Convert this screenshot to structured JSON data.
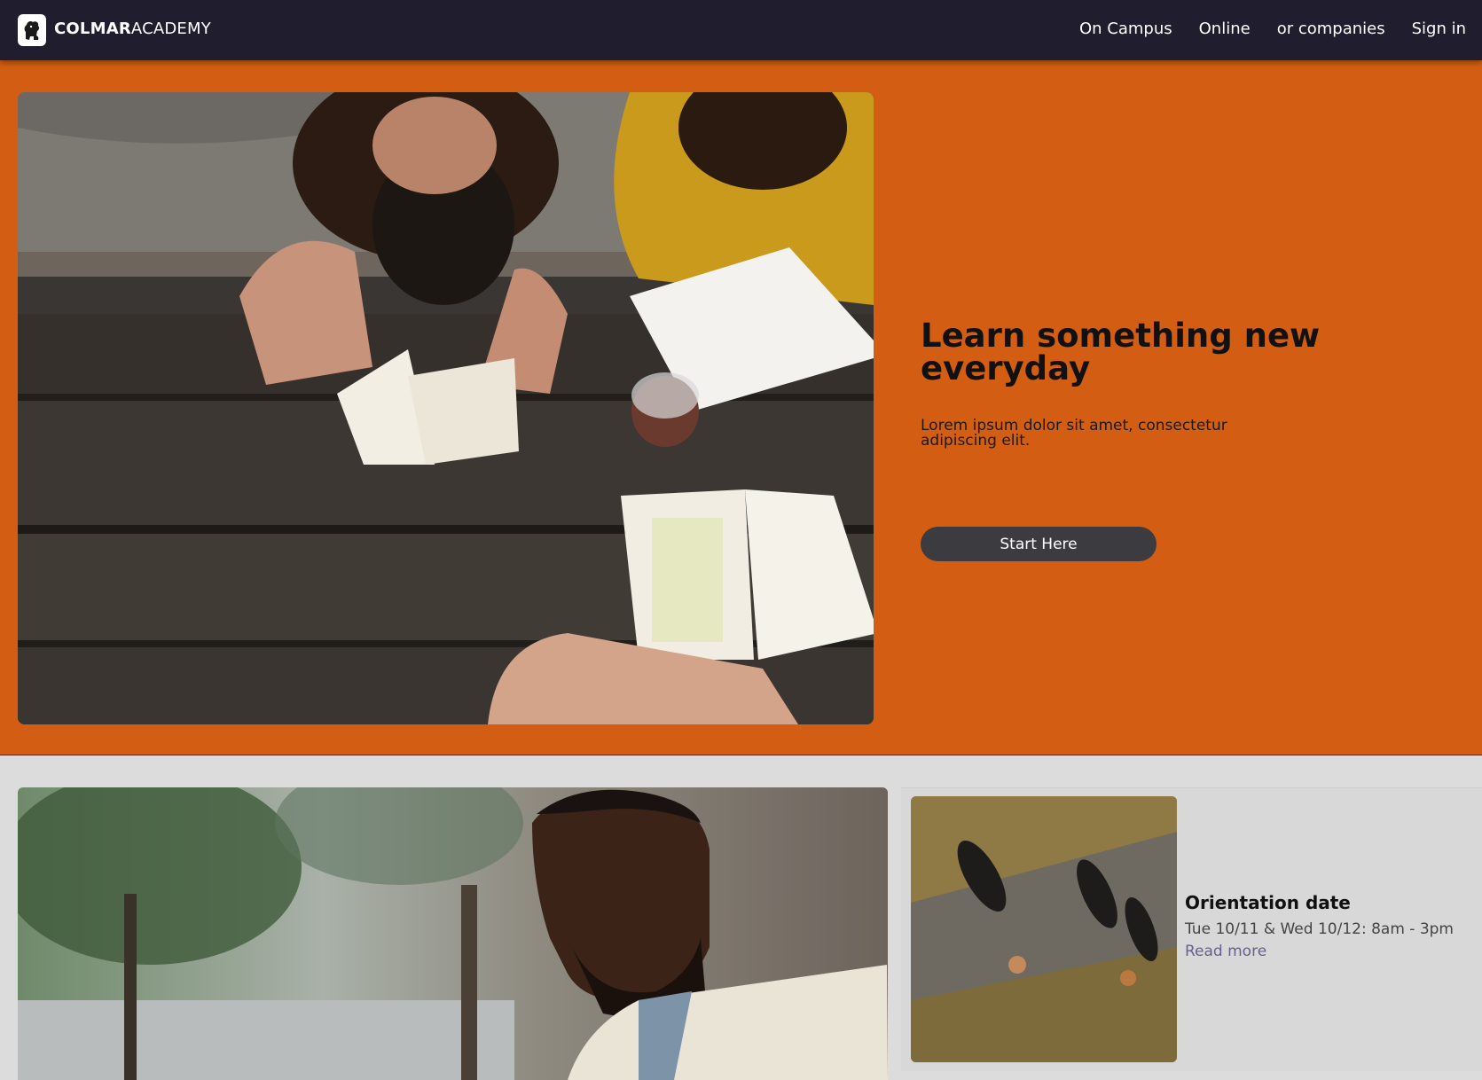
{
  "nav": {
    "brand_bold": "COLMAR",
    "brand_light": "ACADEMY",
    "links": [
      "On Campus",
      "Online",
      "or companies",
      "Sign in"
    ]
  },
  "hero": {
    "title": "Learn something new everyday",
    "subtitle": "Lorem ipsum dolor sit amet, consectetur adipiscing elit.",
    "cta_label": "Start Here"
  },
  "event": {
    "title": "Orientation date",
    "date": "Tue 10/11 & Wed 10/12: 8am - 3pm",
    "link": "Read more"
  },
  "colors": {
    "nav_bg": "#201e2e",
    "hero_bg": "#d35e13",
    "cta_bg": "#3c3c40",
    "page_bg": "#dcdcdc",
    "link": "#6a5f8a"
  }
}
